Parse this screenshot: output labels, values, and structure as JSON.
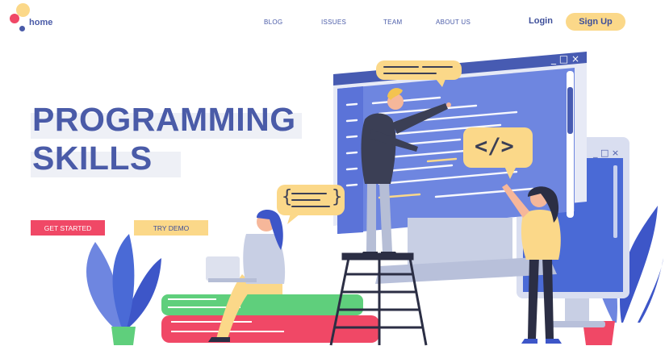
{
  "header": {
    "logo_text": "home",
    "nav": [
      "BLOG",
      "ISSUES",
      "TEAM",
      "ABOUT US"
    ],
    "login_label": "Login",
    "signup_label": "Sign Up"
  },
  "hero": {
    "title_line1": "PROGRAMMING",
    "title_line2": "SKILLS",
    "get_started_label": "GET STARTED",
    "try_demo_label": "TRY DEMO"
  },
  "illustration": {
    "code_tag": "</>",
    "brace_open": "{",
    "brace_close": "}"
  },
  "colors": {
    "brand_blue": "#4a5ba8",
    "accent_red": "#f04866",
    "accent_yellow": "#fbd889",
    "screen_blue": "#6e86e0"
  }
}
